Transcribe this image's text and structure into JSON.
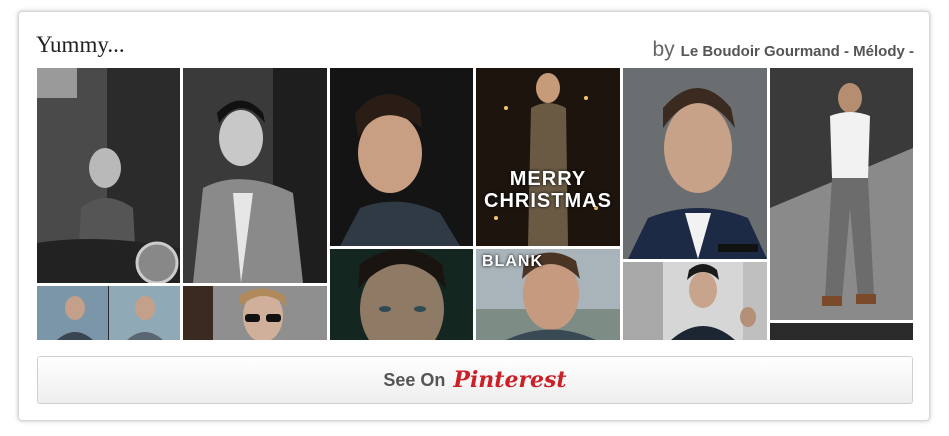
{
  "widget": {
    "title": "Yummy...",
    "by_label": "by",
    "author": "Le Boudoir Gourmand - Mélody -"
  },
  "pins": [
    {
      "icon": "man-on-motorcycle-photo"
    },
    {
      "icon": "man-in-blazer-photo"
    },
    {
      "icon": "man-portrait-photo"
    },
    {
      "icon": "merry-christmas-photo",
      "overlay": "MERRY\nCHRISTMAS"
    },
    {
      "icon": "man-in-suit-photo"
    },
    {
      "icon": "man-walking-photo"
    },
    {
      "icon": "two-men-photo"
    },
    {
      "icon": "man-sunglasses-photo"
    },
    {
      "icon": "man-closeup-photo"
    },
    {
      "icon": "blank-man-photo",
      "overlay": "BLANK"
    },
    {
      "icon": "man-dark-suit-photo"
    },
    {
      "icon": "dark-strip-photo"
    }
  ],
  "footer": {
    "see_on_label": "See On",
    "brand_label": "Pinterest",
    "brand_color": "#cb2027"
  }
}
